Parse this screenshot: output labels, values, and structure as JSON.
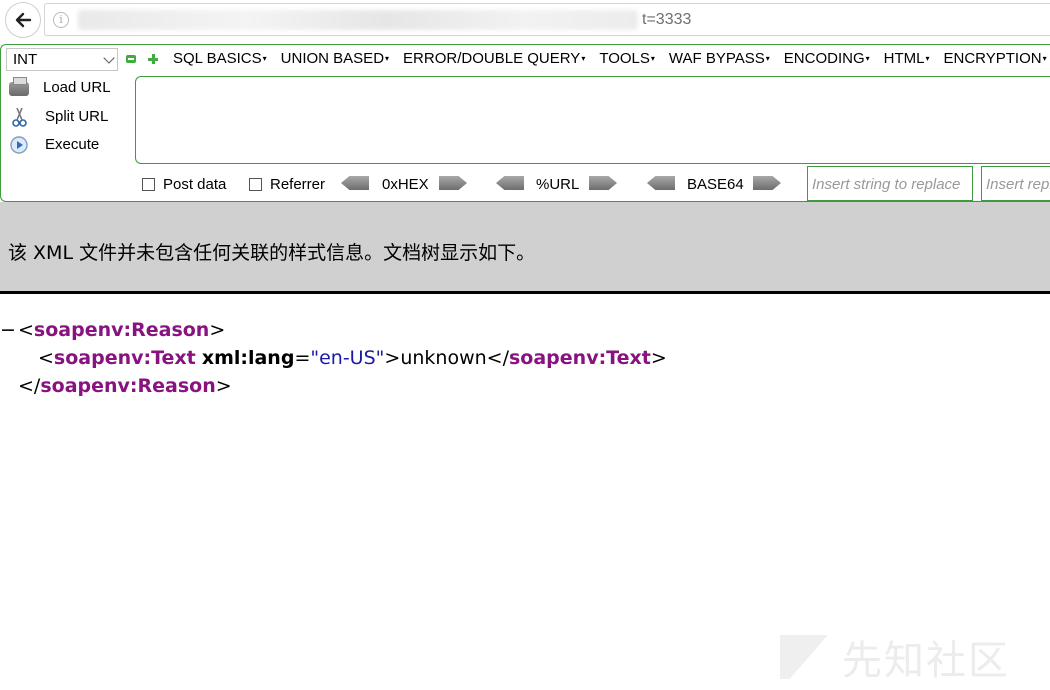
{
  "browser": {
    "url_visible_tail": "t=3333"
  },
  "hackbar": {
    "selector_value": "INT",
    "menu": [
      "SQL BASICS",
      "UNION BASED",
      "ERROR/DOUBLE QUERY",
      "TOOLS",
      "WAF BYPASS",
      "ENCODING",
      "HTML",
      "ENCRYPTION"
    ],
    "load_url": "Load URL",
    "split_url": "Split URL",
    "execute": "Execute",
    "post_data": "Post data",
    "referrer": "Referrer",
    "hex": "0xHEX",
    "url_enc": "%URL",
    "base64": "BASE64",
    "replace_placeholder": "Insert string to replace",
    "replace_with_placeholder": "Insert replacing string"
  },
  "xml_info": "该 XML 文件并未包含任何关联的样式信息。文档树显示如下。",
  "xml": {
    "toggle": "−",
    "root_tag": "soapenv:Reason",
    "child_tag": "soapenv:Text",
    "attr_name": "xml:lang",
    "attr_value": "\"en-US\"",
    "text": "unknown"
  },
  "watermark": "先知社区"
}
